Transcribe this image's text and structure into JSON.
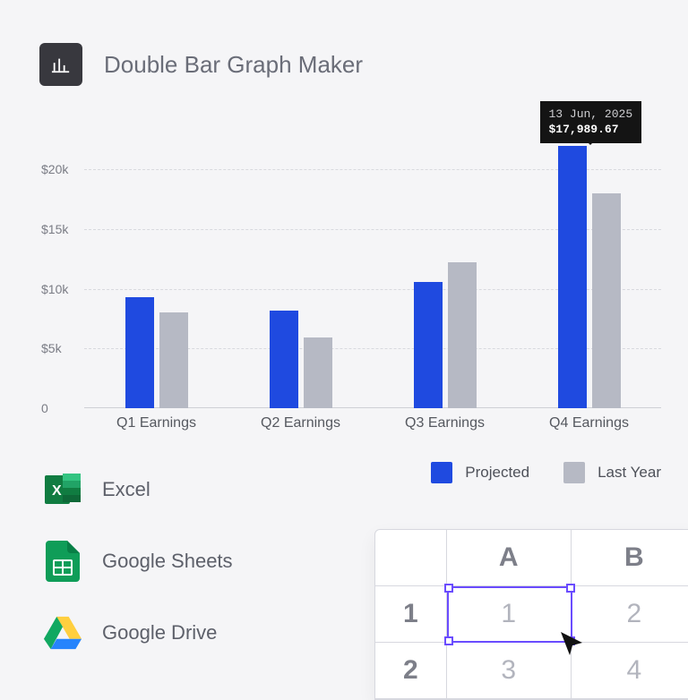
{
  "title": "Double Bar Graph Maker",
  "chart_data": {
    "type": "bar",
    "categories": [
      "Q1 Earnings",
      "Q2 Earnings",
      "Q3 Earnings",
      "Q4 Earnings"
    ],
    "series": [
      {
        "name": "Projected",
        "color": "#1f4ae0",
        "values": [
          9300,
          8200,
          10600,
          22000
        ]
      },
      {
        "name": "Last Year",
        "color": "#b6b9c4",
        "values": [
          8000,
          5900,
          12200,
          17990
        ]
      }
    ],
    "y_ticks": [
      0,
      5000,
      10000,
      15000,
      20000
    ],
    "y_tick_labels": [
      "0",
      "$5k",
      "$10k",
      "$15k",
      "$20k"
    ],
    "ylim": [
      0,
      22500
    ],
    "tooltip": {
      "date": "13 Jun, 2025",
      "value": "$17,989.67",
      "attach": {
        "series": 1,
        "index": 3
      }
    },
    "legend": [
      {
        "label": "Projected",
        "color": "#1f4ae0"
      },
      {
        "label": "Last Year",
        "color": "#b6b9c4"
      }
    ]
  },
  "integrations": [
    {
      "key": "excel",
      "label": "Excel"
    },
    {
      "key": "gsheets",
      "label": "Google Sheets"
    },
    {
      "key": "gdrive",
      "label": "Google Drive"
    }
  ],
  "sheet": {
    "columns": [
      "A",
      "B"
    ],
    "rows": [
      {
        "header": "1",
        "cells": [
          "1",
          "2"
        ]
      },
      {
        "header": "2",
        "cells": [
          "3",
          "4"
        ]
      }
    ],
    "selected": {
      "row": 0,
      "col": 0
    }
  }
}
